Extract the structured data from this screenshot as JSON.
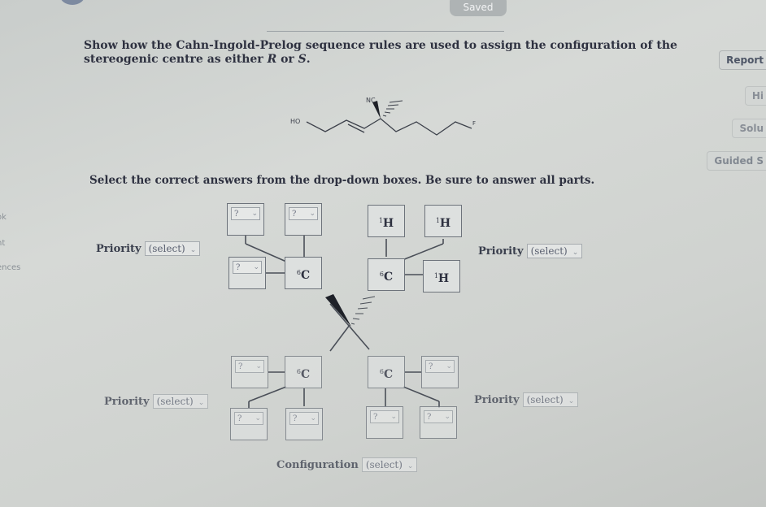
{
  "header": {
    "saved_label": "Saved"
  },
  "question": {
    "prefix": "Show how the Cahn-Ingold-Prelog sequence rules are used to assign the configuration of the stereogenic centre as either ",
    "r": "R",
    "mid": " or ",
    "s": "S",
    "end": "."
  },
  "side_buttons": {
    "report": "Report",
    "hint": "Hi",
    "solution": "Solu",
    "guided": "Guided S"
  },
  "left_tabs": {
    "t1": "ok",
    "t2": "nt",
    "t3": "ences"
  },
  "molecule": {
    "ho": "HO",
    "nc": "NC",
    "f": "F"
  },
  "instruction": "Select the correct answers from the drop-down boxes. Be sure to answer all parts.",
  "placeholder_q": "?",
  "priority_label": "Priority",
  "select_placeholder": "(select)",
  "atoms": {
    "c_mass": "6",
    "c_sym": "C",
    "h_mass": "1",
    "h_sym": "H"
  },
  "configuration_label": "Configuration"
}
